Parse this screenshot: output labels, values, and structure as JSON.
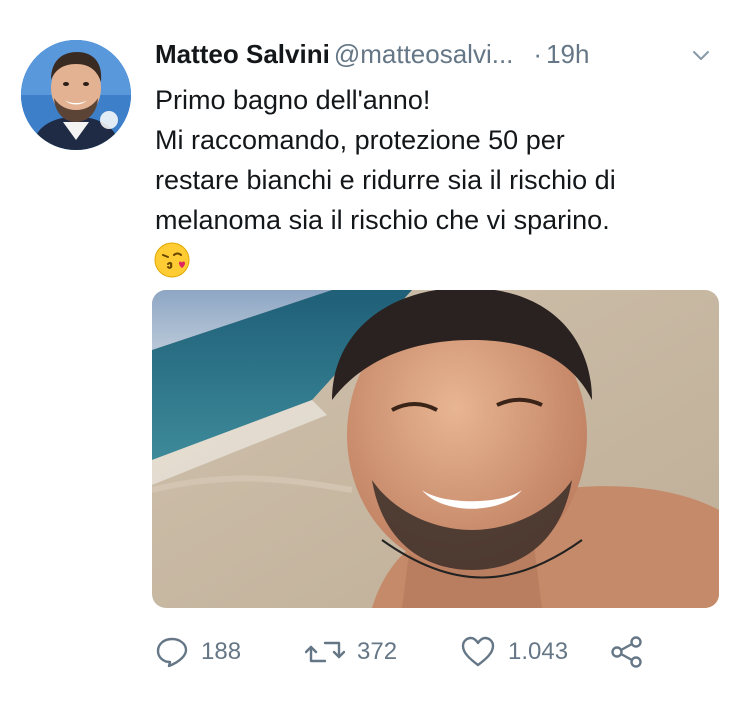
{
  "tweet": {
    "display_name": "Matteo Salvini",
    "handle": "@matteosalvi...",
    "separator": "·",
    "time": "19h",
    "text_lines": [
      "Primo bagno dell'anno!",
      "Mi raccomando, protezione 50 per",
      "restare bianchi e ridurre sia il rischio di",
      "melanoma sia il rischio che vi sparino."
    ],
    "emoji": "face-throwing-kiss-emoji",
    "media": "beach-selfie-photo"
  },
  "actions": {
    "replies": "188",
    "retweets": "372",
    "likes": "1.043"
  },
  "icons": {
    "reply": "speech-bubble-icon",
    "retweet": "retweet-arrows-icon",
    "like": "heart-outline-icon",
    "share": "share-nodes-icon",
    "more": "chevron-down-icon"
  },
  "colors": {
    "text": "#14171a",
    "secondary": "#657786",
    "background": "#ffffff"
  }
}
